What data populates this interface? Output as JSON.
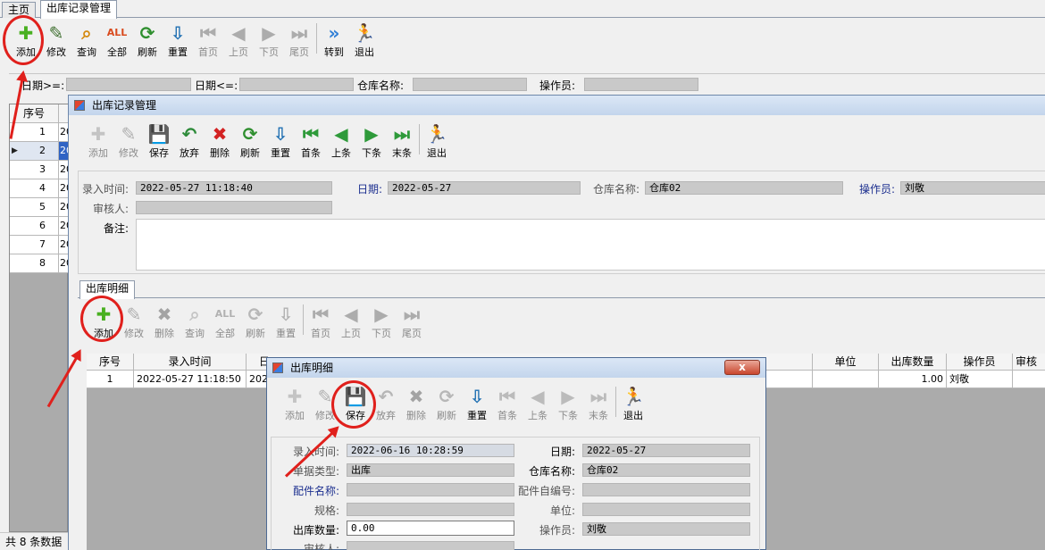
{
  "main_tabs": [
    "主页",
    "出库记录管理"
  ],
  "main_toolbar": [
    {
      "label": "添加",
      "icon": "plus-icon",
      "enabled": true
    },
    {
      "label": "修改",
      "icon": "edit-icon",
      "enabled": true
    },
    {
      "label": "查询",
      "icon": "search-icon",
      "enabled": true
    },
    {
      "label": "全部",
      "icon": "all-icon",
      "enabled": true
    },
    {
      "label": "刷新",
      "icon": "refresh-icon",
      "enabled": true
    },
    {
      "label": "重置",
      "icon": "reset-icon",
      "enabled": true
    },
    {
      "label": "首页",
      "icon": "first-page-icon",
      "enabled": false
    },
    {
      "label": "上页",
      "icon": "prev-page-icon",
      "enabled": false
    },
    {
      "label": "下页",
      "icon": "next-page-icon",
      "enabled": false
    },
    {
      "label": "尾页",
      "icon": "last-page-icon",
      "enabled": false
    },
    {
      "label": "转到",
      "icon": "goto-icon",
      "enabled": true
    },
    {
      "label": "退出",
      "icon": "exit-icon",
      "enabled": true
    }
  ],
  "filter": {
    "date_from": "日期>=:",
    "date_to": "日期<=:",
    "warehouse": "仓库名称:",
    "operator": "操作员:"
  },
  "main_grid": {
    "header": "序号",
    "rows": [
      "1",
      "2",
      "3",
      "4",
      "5",
      "6",
      "7",
      "8"
    ],
    "col2": "20"
  },
  "status_bar": "共 8 条数据",
  "record_window": {
    "title": "出库记录管理",
    "toolbar": [
      {
        "label": "添加",
        "icon": "plus-icon",
        "enabled": false
      },
      {
        "label": "修改",
        "icon": "edit-icon",
        "enabled": false
      },
      {
        "label": "保存",
        "icon": "save-icon",
        "enabled": true
      },
      {
        "label": "放弃",
        "icon": "undo-icon",
        "enabled": true
      },
      {
        "label": "删除",
        "icon": "delete-icon",
        "enabled": true
      },
      {
        "label": "刷新",
        "icon": "refresh-icon",
        "enabled": true
      },
      {
        "label": "重置",
        "icon": "reset-icon",
        "enabled": true
      },
      {
        "label": "首条",
        "icon": "first-record-icon",
        "enabled": true
      },
      {
        "label": "上条",
        "icon": "prev-record-icon",
        "enabled": true
      },
      {
        "label": "下条",
        "icon": "next-record-icon",
        "enabled": true
      },
      {
        "label": "末条",
        "icon": "last-record-icon",
        "enabled": true
      },
      {
        "label": "退出",
        "icon": "exit-icon",
        "enabled": true
      }
    ],
    "entry_time_label": "录入时间:",
    "entry_time": "2022-05-27 11:18:40",
    "date_label": "日期:",
    "date": "2022-05-27",
    "warehouse_label": "仓库名称:",
    "warehouse": "仓库02",
    "operator_label": "操作员:",
    "operator": "刘敬",
    "reviewer_label": "审核人:",
    "reviewer": "",
    "remark_label": "备注:",
    "remark": "",
    "detail_tab": "出库明细",
    "detail_toolbar": [
      {
        "label": "添加",
        "icon": "plus-icon",
        "enabled": true
      },
      {
        "label": "修改",
        "icon": "edit-icon",
        "enabled": false
      },
      {
        "label": "删除",
        "icon": "delete-icon",
        "enabled": false
      },
      {
        "label": "查询",
        "icon": "search-icon",
        "enabled": false
      },
      {
        "label": "全部",
        "icon": "all-icon",
        "enabled": false
      },
      {
        "label": "刷新",
        "icon": "refresh-icon",
        "enabled": false
      },
      {
        "label": "重置",
        "icon": "reset-icon",
        "enabled": false
      },
      {
        "label": "首页",
        "icon": "first-page-icon",
        "enabled": false
      },
      {
        "label": "上页",
        "icon": "prev-page-icon",
        "enabled": false
      },
      {
        "label": "下页",
        "icon": "next-page-icon",
        "enabled": false
      },
      {
        "label": "尾页",
        "icon": "last-page-icon",
        "enabled": false
      }
    ],
    "detail_grid": {
      "headers": {
        "no": "序号",
        "time": "录入时间",
        "date_partial": "日",
        "unit": "单位",
        "qty": "出库数量",
        "operator": "操作员",
        "reviewer_partial": "审核"
      },
      "row": {
        "no": "1",
        "time": "2022-05-27 11:18:50",
        "date_partial": "2022",
        "unit": "",
        "qty": "1.00",
        "operator": "刘敬"
      }
    }
  },
  "detail_window": {
    "title": "出库明细",
    "close": "x",
    "toolbar": [
      {
        "label": "添加",
        "icon": "plus-icon",
        "enabled": false
      },
      {
        "label": "修改",
        "icon": "edit-icon",
        "enabled": false
      },
      {
        "label": "保存",
        "icon": "save-icon",
        "enabled": true
      },
      {
        "label": "放弃",
        "icon": "undo-icon",
        "enabled": false
      },
      {
        "label": "删除",
        "icon": "delete-icon",
        "enabled": false
      },
      {
        "label": "刷新",
        "icon": "refresh-icon",
        "enabled": false
      },
      {
        "label": "重置",
        "icon": "reset-icon",
        "enabled": true
      },
      {
        "label": "首条",
        "icon": "first-record-icon",
        "enabled": false
      },
      {
        "label": "上条",
        "icon": "prev-record-icon",
        "enabled": false
      },
      {
        "label": "下条",
        "icon": "next-record-icon",
        "enabled": false
      },
      {
        "label": "末条",
        "icon": "last-record-icon",
        "enabled": false
      },
      {
        "label": "退出",
        "icon": "exit-icon",
        "enabled": true
      }
    ],
    "entry_time_label": "录入时间:",
    "entry_time": "2022-06-16 10:28:59",
    "date_label": "日期:",
    "date": "2022-05-27",
    "doc_type_label": "单据类型:",
    "doc_type": "出库",
    "warehouse_label": "仓库名称:",
    "warehouse": "仓库02",
    "part_name_label": "配件名称:",
    "part_name": "",
    "part_code_label": "配件自编号:",
    "part_code": "",
    "spec_label": "规格:",
    "spec": "",
    "unit_label": "单位:",
    "unit": "",
    "qty_label": "出库数量:",
    "qty": "0.00",
    "operator_label": "操作员:",
    "operator": "刘敬",
    "reviewer_label": "审核人:",
    "reviewer": ""
  },
  "colors": {
    "highlight": "#e0201c",
    "title_blue": "#1c2f8f",
    "field_gray": "#c9c9c9"
  }
}
